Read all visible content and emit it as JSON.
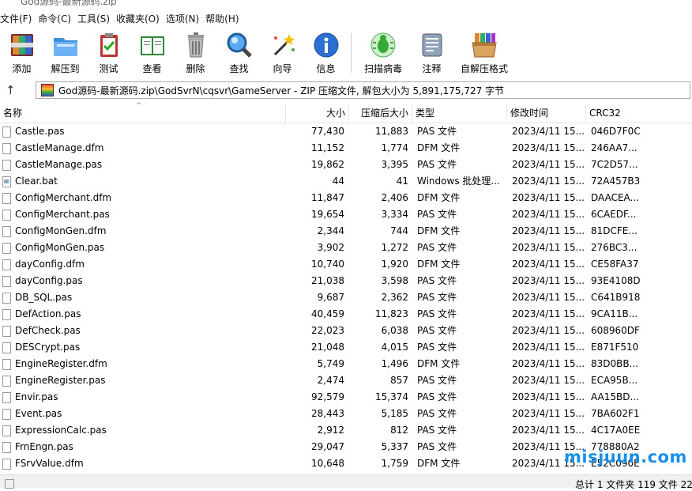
{
  "window": {
    "title": "God源码-最新源码.zip"
  },
  "menu": [
    "文件(F)",
    "命令(C)",
    "工具(S)",
    "收藏夹(O)",
    "选项(N)",
    "帮助(H)"
  ],
  "toolbar": [
    {
      "label": "添加",
      "icon": "add-archive-icon"
    },
    {
      "label": "解压到",
      "icon": "extract-folder-icon"
    },
    {
      "label": "测试",
      "icon": "test-clipboard-icon"
    },
    {
      "label": "查看",
      "icon": "view-book-icon"
    },
    {
      "label": "删除",
      "icon": "trash-icon"
    },
    {
      "label": "查找",
      "icon": "magnifier-icon"
    },
    {
      "label": "向导",
      "icon": "wizard-wand-icon"
    },
    {
      "label": "信息",
      "icon": "info-icon"
    },
    {
      "label": "扫描病毒",
      "icon": "virus-scan-icon"
    },
    {
      "label": "注释",
      "icon": "comment-icon"
    },
    {
      "label": "自解压格式",
      "icon": "sfx-box-icon"
    }
  ],
  "address": {
    "path": "God源码-最新源码.zip\\GodSvrN\\cqsvr\\GameServer - ZIP 压缩文件, 解包大小为 5,891,175,727 字节"
  },
  "columns": {
    "name": "名称",
    "size": "大小",
    "packed": "压缩后大小",
    "type": "类型",
    "modified": "修改时间",
    "crc": "CRC32"
  },
  "files": [
    {
      "name": "Castle.pas",
      "size": "77,430",
      "packed": "11,883",
      "type": "PAS 文件",
      "modified": "2023/4/11 15...",
      "crc": "046D7F0C"
    },
    {
      "name": "CastleManage.dfm",
      "size": "11,152",
      "packed": "1,774",
      "type": "DFM 文件",
      "modified": "2023/4/11 15...",
      "crc": "246AA7..."
    },
    {
      "name": "CastleManage.pas",
      "size": "19,862",
      "packed": "3,395",
      "type": "PAS 文件",
      "modified": "2023/4/11 15...",
      "crc": "7C2D57..."
    },
    {
      "name": "Clear.bat",
      "size": "44",
      "packed": "41",
      "type": "Windows 批处理...",
      "modified": "2023/4/11 15...",
      "crc": "72A457B3",
      "bat": true
    },
    {
      "name": "ConfigMerchant.dfm",
      "size": "11,847",
      "packed": "2,406",
      "type": "DFM 文件",
      "modified": "2023/4/11 15...",
      "crc": "DAACEA..."
    },
    {
      "name": "ConfigMerchant.pas",
      "size": "19,654",
      "packed": "3,334",
      "type": "PAS 文件",
      "modified": "2023/4/11 15...",
      "crc": "6CAEDF..."
    },
    {
      "name": "ConfigMonGen.dfm",
      "size": "2,344",
      "packed": "744",
      "type": "DFM 文件",
      "modified": "2023/4/11 15...",
      "crc": "81DCFE..."
    },
    {
      "name": "ConfigMonGen.pas",
      "size": "3,902",
      "packed": "1,272",
      "type": "PAS 文件",
      "modified": "2023/4/11 15...",
      "crc": "276BC3..."
    },
    {
      "name": "dayConfig.dfm",
      "size": "10,740",
      "packed": "1,920",
      "type": "DFM 文件",
      "modified": "2023/4/11 15...",
      "crc": "CE58FA37"
    },
    {
      "name": "dayConfig.pas",
      "size": "21,038",
      "packed": "3,598",
      "type": "PAS 文件",
      "modified": "2023/4/11 15...",
      "crc": "93E4108D"
    },
    {
      "name": "DB_SQL.pas",
      "size": "9,687",
      "packed": "2,362",
      "type": "PAS 文件",
      "modified": "2023/4/11 15...",
      "crc": "C641B918"
    },
    {
      "name": "DefAction.pas",
      "size": "40,459",
      "packed": "11,823",
      "type": "PAS 文件",
      "modified": "2023/4/11 15...",
      "crc": "9CA11B..."
    },
    {
      "name": "DefCheck.pas",
      "size": "22,023",
      "packed": "6,038",
      "type": "PAS 文件",
      "modified": "2023/4/11 15...",
      "crc": "608960DF"
    },
    {
      "name": "DESCrypt.pas",
      "size": "21,048",
      "packed": "4,015",
      "type": "PAS 文件",
      "modified": "2023/4/11 15...",
      "crc": "E871F510"
    },
    {
      "name": "EngineRegister.dfm",
      "size": "5,749",
      "packed": "1,496",
      "type": "DFM 文件",
      "modified": "2023/4/11 15...",
      "crc": "83D0BB..."
    },
    {
      "name": "EngineRegister.pas",
      "size": "2,474",
      "packed": "857",
      "type": "PAS 文件",
      "modified": "2023/4/11 15...",
      "crc": "ECA95B..."
    },
    {
      "name": "Envir.pas",
      "size": "92,579",
      "packed": "15,374",
      "type": "PAS 文件",
      "modified": "2023/4/11 15...",
      "crc": "AA15BD..."
    },
    {
      "name": "Event.pas",
      "size": "28,443",
      "packed": "5,185",
      "type": "PAS 文件",
      "modified": "2023/4/11 15...",
      "crc": "7BA602F1"
    },
    {
      "name": "ExpressionCalc.pas",
      "size": "2,912",
      "packed": "812",
      "type": "PAS 文件",
      "modified": "2023/4/11 15...",
      "crc": "4C17A0EE"
    },
    {
      "name": "FrnEngn.pas",
      "size": "29,047",
      "packed": "5,337",
      "type": "PAS 文件",
      "modified": "2023/4/11 15...",
      "crc": "778880A2"
    },
    {
      "name": "FSrvValue.dfm",
      "size": "10,648",
      "packed": "1,759",
      "type": "DFM 文件",
      "modified": "2023/4/11 15...",
      "crc": "E52C090E"
    }
  ],
  "status": {
    "text": "总计 1 文件夹 119 文件 22"
  },
  "watermark": "misjuun.com"
}
